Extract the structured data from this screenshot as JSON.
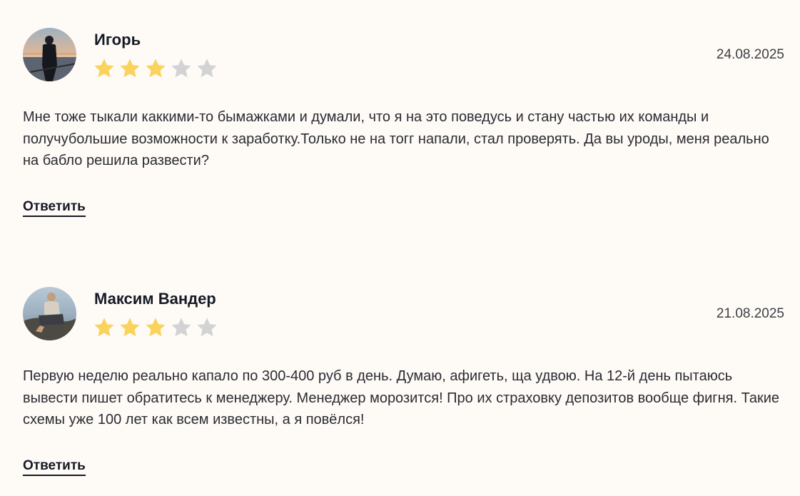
{
  "reviews": [
    {
      "author": "Игорь",
      "date": "24.08.2025",
      "rating": 3,
      "rating_max": 5,
      "text": "Мне тоже тыкали каккими-то бымажками и думали, что я на это поведусь и стану частью их команды и получубольшие возможности к заработку.Только не на тогг напали, стал проверять. Да вы уроды, меня реально на бабло решила развести?",
      "reply_label": "Ответить"
    },
    {
      "author": "Максим Вандер",
      "date": "21.08.2025",
      "rating": 3,
      "rating_max": 5,
      "text": "Первую неделю реально капало по 300-400 руб в день. Думаю, афигеть, ща удвою. На 12-й день пытаюсь вывести пишет обратитесь к менеджеру. Менеджер морозится! Про их страховку депозитов вообще фигня. Такие схемы уже 100 лет как всем известны, а я повёлся!",
      "reply_label": "Ответить"
    }
  ],
  "colors": {
    "background": "#fefaf6",
    "star_filled": "#f9d35c",
    "star_empty": "#d3d3d6",
    "text": "#2a2c33",
    "heading": "#161a26"
  },
  "icons": {
    "star": "star-icon",
    "avatar": "avatar"
  }
}
